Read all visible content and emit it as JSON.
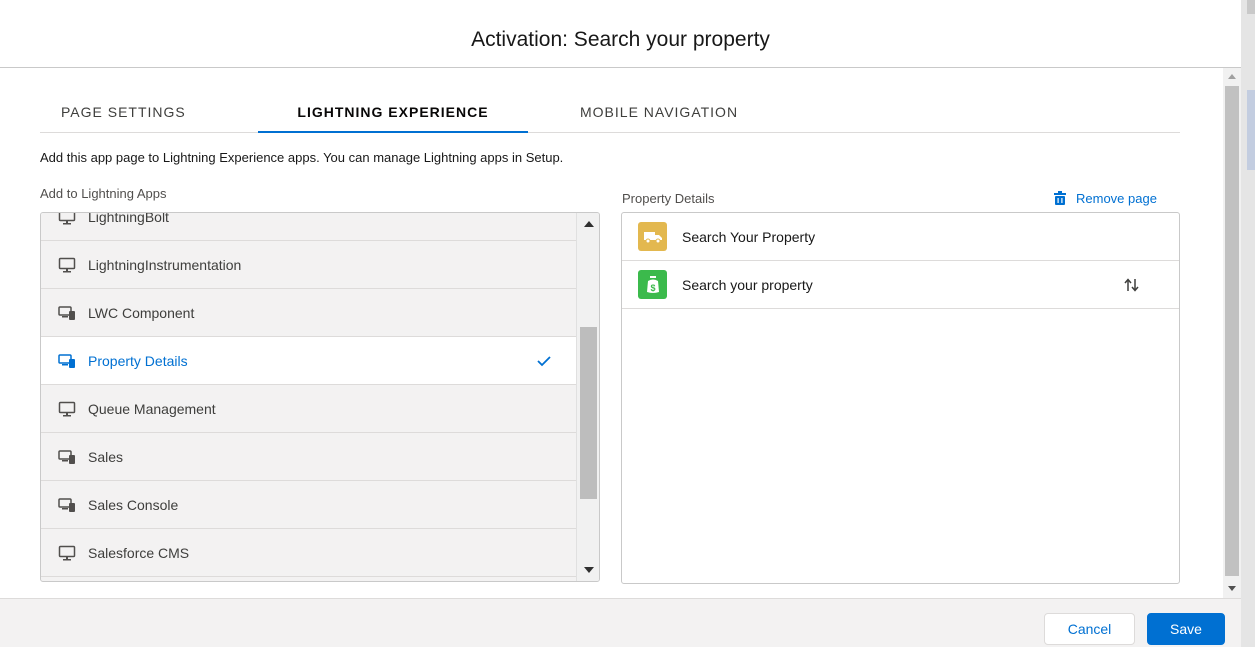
{
  "modal": {
    "title": "Activation: Search your property"
  },
  "tabs": [
    {
      "label": "PAGE SETTINGS",
      "active": false
    },
    {
      "label": "LIGHTNING EXPERIENCE",
      "active": true
    },
    {
      "label": "MOBILE NAVIGATION",
      "active": false
    }
  ],
  "info_text": "Add this app page to Lightning Experience apps. You can manage Lightning apps in Setup.",
  "apps_panel": {
    "label": "Add to Lightning Apps",
    "items": [
      {
        "label": "LightningBolt",
        "icon": "desktop-icon",
        "selected": false
      },
      {
        "label": "LightningInstrumentation",
        "icon": "desktop-icon",
        "selected": false
      },
      {
        "label": "LWC Component",
        "icon": "desktop-phone-icon",
        "selected": false
      },
      {
        "label": "Property Details",
        "icon": "desktop-phone-icon",
        "selected": true
      },
      {
        "label": "Queue Management",
        "icon": "desktop-icon",
        "selected": false
      },
      {
        "label": "Sales",
        "icon": "desktop-phone-icon",
        "selected": false
      },
      {
        "label": "Sales Console",
        "icon": "desktop-phone-icon",
        "selected": false
      },
      {
        "label": "Salesforce CMS",
        "icon": "desktop-icon",
        "selected": false
      }
    ]
  },
  "details_panel": {
    "label": "Property Details",
    "remove_label": "Remove page",
    "items": [
      {
        "label": "Search Your Property",
        "icon": "truck-icon",
        "color": "#e3b84f"
      },
      {
        "label": "Search your property",
        "icon": "money-bag-icon",
        "color": "#3bba4c"
      }
    ]
  },
  "footer": {
    "cancel_label": "Cancel",
    "save_label": "Save"
  },
  "colors": {
    "brand": "#0070d2",
    "selected_text": "#0070d2"
  }
}
